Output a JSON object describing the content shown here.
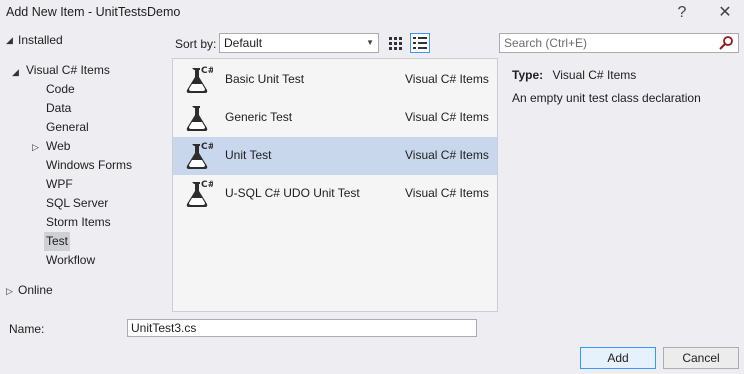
{
  "window": {
    "title": "Add New Item - UnitTestsDemo",
    "help_glyph": "?",
    "close_glyph": "✕"
  },
  "tree": {
    "installed": "Installed",
    "root": "Visual C# Items",
    "children": [
      "Code",
      "Data",
      "General",
      "Web",
      "Windows Forms",
      "WPF",
      "SQL Server",
      "Storm Items",
      "Test",
      "Workflow"
    ],
    "selected": "Test",
    "online": "Online"
  },
  "toolbar": {
    "sort_label": "Sort by:",
    "sort_value": "Default"
  },
  "templates": [
    {
      "name": "Basic Unit Test",
      "language": "Visual C# Items",
      "icon": "flask-csharp-icon",
      "selected": false
    },
    {
      "name": "Generic Test",
      "language": "Visual C# Items",
      "icon": "flask-icon",
      "selected": false
    },
    {
      "name": "Unit Test",
      "language": "Visual C# Items",
      "icon": "flask-csharp-icon",
      "selected": true
    },
    {
      "name": "U-SQL C# UDO Unit Test",
      "language": "Visual C# Items",
      "icon": "flask-csharp-icon",
      "selected": false
    }
  ],
  "search": {
    "placeholder": "Search (Ctrl+E)"
  },
  "details": {
    "type_label": "Type:",
    "type_value": "Visual C# Items",
    "description": "An empty unit test class declaration"
  },
  "name_field": {
    "label": "Name:",
    "value": "UnitTest3.cs"
  },
  "buttons": {
    "add": "Add",
    "cancel": "Cancel"
  },
  "colors": {
    "dialog_bg": "#eeeef2",
    "selection": "#c9d7ec",
    "accent": "#3399ff"
  }
}
